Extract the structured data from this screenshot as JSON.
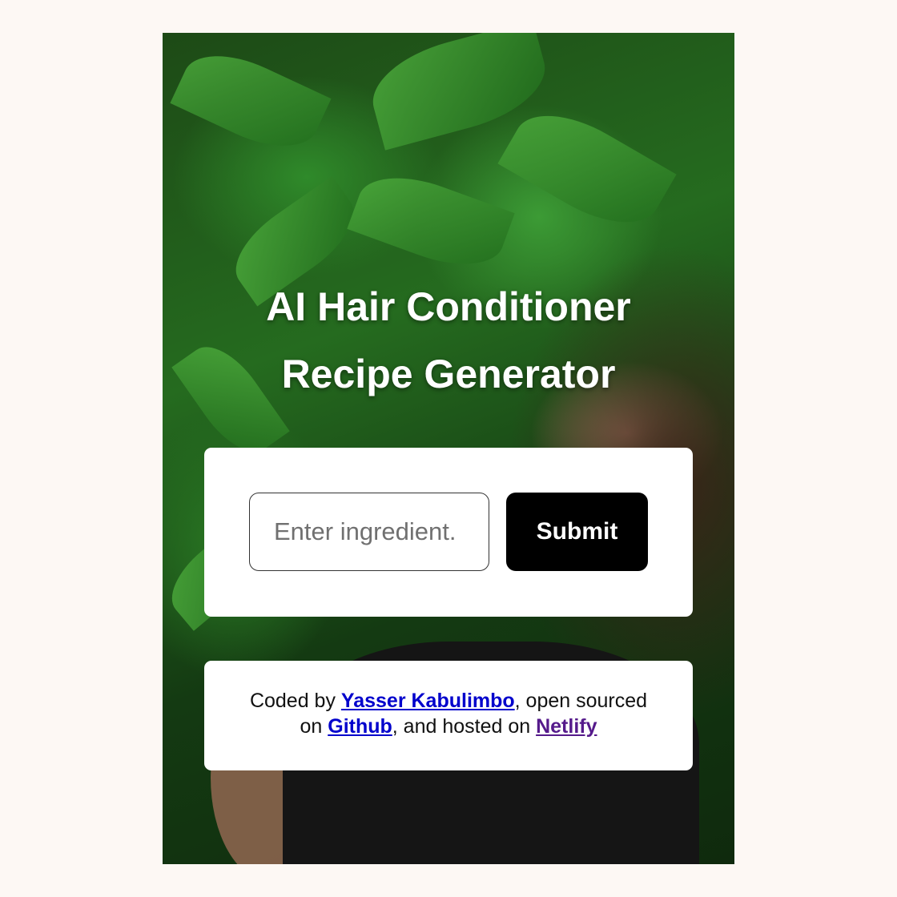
{
  "header": {
    "title_line1": "AI Hair Conditioner",
    "title_line2": "Recipe Generator"
  },
  "form": {
    "input_placeholder": "Enter ingredient.",
    "submit_label": "Submit"
  },
  "footer": {
    "text_coded_by": "Coded by ",
    "author_link": "Yasser Kabulimbo",
    "text_open_sourced": ", open sourced",
    "text_on": "on ",
    "github_link": "Github",
    "text_hosted": ", and hosted on ",
    "netlify_link": "Netlify"
  },
  "colors": {
    "page_background": "#fdf8f4",
    "button_background": "#000000",
    "link_color": "#0000cc",
    "visited_link_color": "#551a8b"
  }
}
